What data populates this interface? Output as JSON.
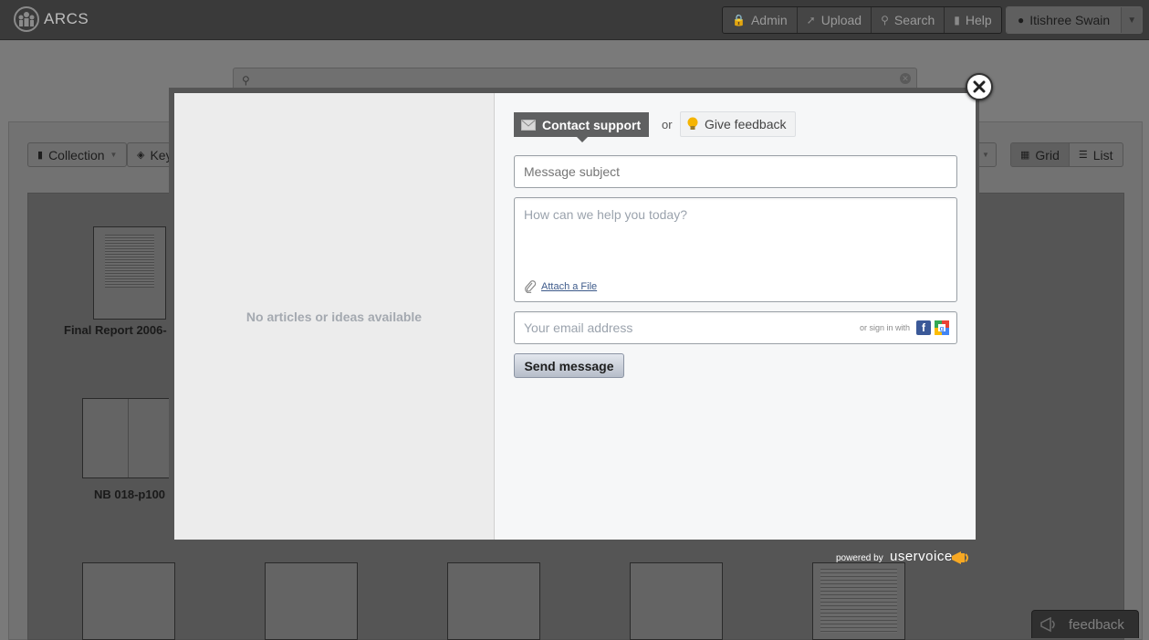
{
  "app": {
    "name": "ARCS"
  },
  "nav": {
    "buttons": [
      {
        "label": "Admin",
        "icon": "lock-icon"
      },
      {
        "label": "Upload",
        "icon": "upload-icon"
      },
      {
        "label": "Search",
        "icon": "search-icon"
      },
      {
        "label": "Help",
        "icon": "book-icon"
      }
    ],
    "user": {
      "name": "Itishree Swain"
    }
  },
  "page": {
    "search_value": "",
    "toolbar": {
      "collection_label": "Collection",
      "keyword_label": "Key",
      "grid_label": "Grid",
      "list_label": "List"
    },
    "thumbnails": [
      {
        "label": "Final Report 2006-"
      },
      {
        "label": "NB 018-p100"
      }
    ]
  },
  "modal": {
    "left_empty_message": "No articles or ideas available",
    "tabs": {
      "contact_label": "Contact support",
      "or_text": "or",
      "feedback_label": "Give feedback"
    },
    "form": {
      "subject_placeholder": "Message subject",
      "message_placeholder": "How can we help you today?",
      "attach_label": "Attach a File",
      "email_placeholder": "Your email address",
      "signin_text": "or sign in with",
      "send_label": "Send message"
    },
    "powered_by": "powered by",
    "brand": "uservoice"
  },
  "feedback_tab": {
    "label": "feedback"
  },
  "colors": {
    "topbar": "#3a3a3a",
    "contact_tab": "#5f6061",
    "link": "#3d5a8a",
    "facebook": "#3b5998"
  }
}
